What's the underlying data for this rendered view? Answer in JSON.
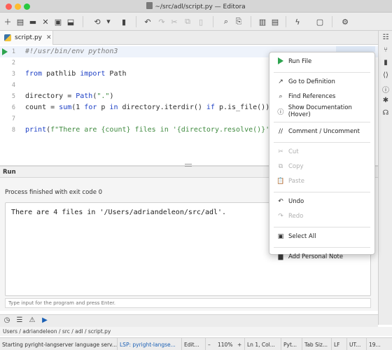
{
  "window": {
    "title": "~/src/adl/script.py — Editora",
    "controls": {
      "close": "#fe5f57",
      "minimize": "#febc2e",
      "maximize": "#28c840"
    }
  },
  "toolbar": {
    "groups": [
      [
        "new-file-icon",
        "new-document-icon",
        "open-folder-icon",
        "close-icon",
        "save-icon",
        "save-as-icon"
      ],
      [
        "history-icon",
        "dropdown-chevron-icon",
        "trash-icon"
      ],
      [
        "undo-icon",
        "redo-icon",
        "cut-icon",
        "copy-icon",
        "paste-icon"
      ],
      [
        "search-icon",
        "find-in-files-icon"
      ],
      [
        "split-columns-icon",
        "split-rows-icon"
      ],
      [
        "lightning-icon",
        "frame-icon"
      ],
      [
        "settings-gear-icon"
      ]
    ]
  },
  "tabs": [
    {
      "label": "script.py",
      "close": "✕"
    }
  ],
  "editor": {
    "lines": [
      {
        "n": "1",
        "tokens": [
          {
            "t": "#!/usr/bin/env python3",
            "c": "com"
          }
        ]
      },
      {
        "n": "2",
        "tokens": []
      },
      {
        "n": "3",
        "tokens": [
          {
            "t": "from",
            "c": "kw"
          },
          {
            "t": " pathlib ",
            "c": ""
          },
          {
            "t": "import",
            "c": "kw"
          },
          {
            "t": " Path",
            "c": ""
          }
        ]
      },
      {
        "n": "4",
        "tokens": []
      },
      {
        "n": "5",
        "tokens": [
          {
            "t": "directory = ",
            "c": ""
          },
          {
            "t": "Path",
            "c": "kw"
          },
          {
            "t": "(",
            "c": ""
          },
          {
            "t": "\".\"",
            "c": "str"
          },
          {
            "t": ")",
            "c": ""
          }
        ]
      },
      {
        "n": "6",
        "tokens": [
          {
            "t": "count = ",
            "c": ""
          },
          {
            "t": "sum",
            "c": "kw"
          },
          {
            "t": "(1 ",
            "c": ""
          },
          {
            "t": "for",
            "c": "kw"
          },
          {
            "t": " p ",
            "c": ""
          },
          {
            "t": "in",
            "c": "kw"
          },
          {
            "t": " directory.iterdir() ",
            "c": ""
          },
          {
            "t": "if",
            "c": "kw"
          },
          {
            "t": " p.is_file())",
            "c": ""
          }
        ]
      },
      {
        "n": "7",
        "tokens": []
      },
      {
        "n": "8",
        "tokens": [
          {
            "t": "print",
            "c": "kw"
          },
          {
            "t": "(",
            "c": ""
          },
          {
            "t": "f\"There are {count} files in '{directory.resolve()}'.\"",
            "c": "str"
          },
          {
            "t": ")",
            "c": ""
          }
        ]
      }
    ]
  },
  "run_panel": {
    "title": "Run",
    "exit_message": "Process finished with exit code 0",
    "output": "There are 4 files in '/Users/adriandeleon/src/adl'.",
    "input_placeholder": "Type input for the program and press Enter."
  },
  "context_menu": {
    "items": [
      {
        "label": "Run File",
        "icon": "run-icon",
        "glyph": "",
        "enabled": true
      },
      {
        "sep": true
      },
      {
        "label": "Go to Definition",
        "icon": "arrow-up-right-icon",
        "glyph": "↗",
        "enabled": true
      },
      {
        "label": "Find References",
        "icon": "search-icon",
        "glyph": "⌕",
        "enabled": true
      },
      {
        "label": "Show Documentation (Hover)",
        "icon": "info-icon",
        "glyph": "ⓘ",
        "enabled": true
      },
      {
        "sep": true
      },
      {
        "label": "Comment / Uncomment",
        "icon": "comment-slashes-icon",
        "glyph": "//",
        "enabled": true
      },
      {
        "sep": true
      },
      {
        "label": "Cut",
        "icon": "scissors-icon",
        "glyph": "✂",
        "enabled": false
      },
      {
        "label": "Copy",
        "icon": "copy-icon",
        "glyph": "⧉",
        "enabled": false
      },
      {
        "label": "Paste",
        "icon": "clipboard-icon",
        "glyph": "📋",
        "enabled": false
      },
      {
        "sep": true
      },
      {
        "label": "Undo",
        "icon": "undo-icon",
        "glyph": "↶",
        "enabled": true
      },
      {
        "label": "Redo",
        "icon": "redo-icon",
        "glyph": "↷",
        "enabled": false
      },
      {
        "sep": true
      },
      {
        "label": "Select All",
        "icon": "select-all-icon",
        "glyph": "▣",
        "enabled": true
      },
      {
        "sep": true
      },
      {
        "label": "Add Personal Note",
        "icon": "note-icon",
        "glyph": "▆",
        "enabled": true
      }
    ]
  },
  "right_sidebar": {
    "icons": [
      "tree-structure-icon",
      "hierarchy-icon",
      "bookmark-icon",
      "code-brackets-icon",
      "info-circle-icon",
      "bug-icon",
      "headset-icon"
    ]
  },
  "bottom_bar": {
    "icons": [
      "clock-icon",
      "tasks-list-icon",
      "warning-icon",
      "run-play-icon"
    ]
  },
  "breadcrumb": "Users / adriandeleon / src / adl / script.py",
  "status_bar": [
    {
      "name": "status-message",
      "text": "Starting pyright-langserver language serv..."
    },
    {
      "name": "status-lsp",
      "text": "LSP: pyright-langse..."
    },
    {
      "name": "status-edit-mode",
      "text": "Edit..."
    },
    {
      "name": "status-zoom-out",
      "text": "–"
    },
    {
      "name": "status-zoom",
      "text": "110%"
    },
    {
      "name": "status-zoom-in",
      "text": "+"
    },
    {
      "name": "status-position",
      "text": "Ln 1, Col..."
    },
    {
      "name": "status-language",
      "text": "Pyt..."
    },
    {
      "name": "status-tab-size",
      "text": "Tab Siz..."
    },
    {
      "name": "status-line-ending",
      "text": "LF"
    },
    {
      "name": "status-encoding",
      "text": "UT..."
    },
    {
      "name": "status-extra",
      "text": "19..."
    }
  ],
  "colors": {
    "run_green": "#2ea44f",
    "keyword": "#1c3fc5",
    "string": "#3f8a3f",
    "comment": "#7c7c7c",
    "lsp_link": "#1a5fb4",
    "current_line": "#eef3fb"
  }
}
